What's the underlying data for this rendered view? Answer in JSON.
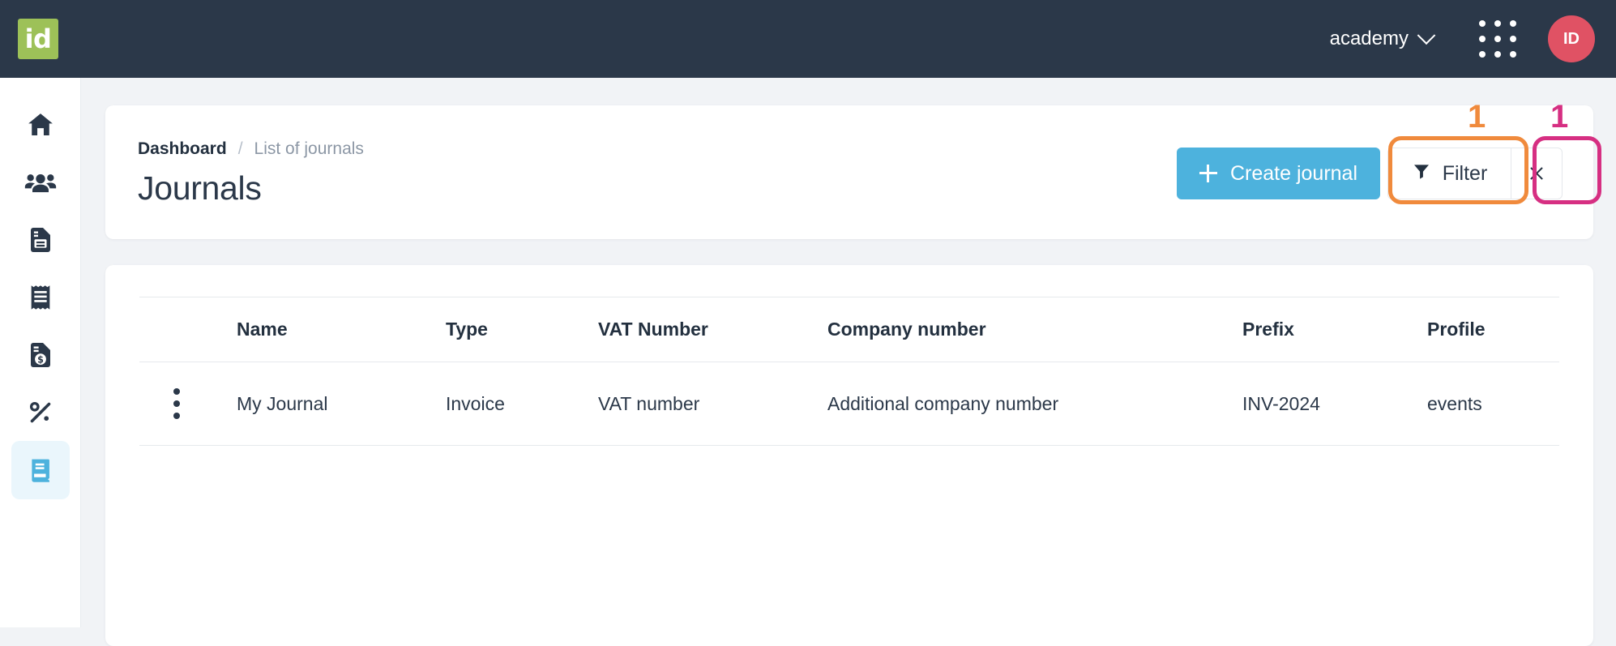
{
  "topbar": {
    "logo_text": "id",
    "logo_color": "#9dc158",
    "bg_color": "#2b3849",
    "org_name": "academy",
    "org_chevron_icon": "chevron-down-icon",
    "apps_icon": "apps-grid-icon",
    "avatar_initials": "ID",
    "avatar_color": "#e05264"
  },
  "sidebar": {
    "items": [
      {
        "icon": "home-icon",
        "label": "Home",
        "active": false
      },
      {
        "icon": "people-icon",
        "label": "Contacts",
        "active": false
      },
      {
        "icon": "document-icon",
        "label": "Documents",
        "active": false
      },
      {
        "icon": "receipt-icon",
        "label": "Receipts",
        "active": false
      },
      {
        "icon": "invoice-icon",
        "label": "Invoices",
        "active": false
      },
      {
        "icon": "percent-icon",
        "label": "Taxes",
        "active": false
      },
      {
        "icon": "book-icon",
        "label": "Journals",
        "active": true
      }
    ],
    "active_bg": "#eaf6fc",
    "active_icon_color": "#4db2dd"
  },
  "header": {
    "breadcrumb": {
      "home": "Dashboard",
      "separator": "/",
      "current": "List of journals"
    },
    "title": "Journals",
    "actions": {
      "create_label": "Create journal",
      "create_icon": "plus-icon",
      "create_color": "#4db2dd",
      "filter_label": "Filter",
      "filter_icon": "funnel-icon",
      "clear_filter_icon": "close-icon"
    }
  },
  "annotations": [
    {
      "number": "1",
      "color": "#f08a3c",
      "target": "filter-button"
    },
    {
      "number": "1",
      "color": "#d62f82",
      "target": "clear-filter-button"
    }
  ],
  "table": {
    "menu_icon": "kebab-menu-icon",
    "columns": [
      "",
      "Name",
      "Type",
      "VAT Number",
      "Company number",
      "Prefix",
      "Profile"
    ],
    "rows": [
      {
        "name": "My Journal",
        "type": "Invoice",
        "vat_number": "VAT number",
        "company_number": "Additional company number",
        "prefix": "INV-2024",
        "profile": "events"
      }
    ],
    "link_color": "#4db2dd"
  }
}
